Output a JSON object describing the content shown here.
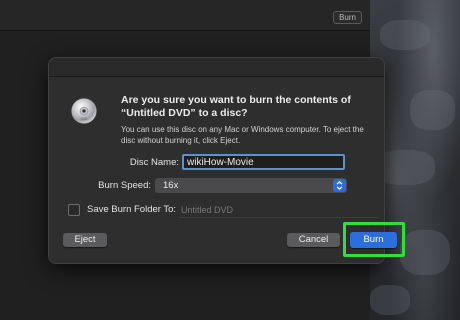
{
  "background_window": {
    "burn_label": "Burn"
  },
  "dialog": {
    "title": "Are you sure you want to burn the contents of “Untitled DVD” to a disc?",
    "description": "You can use this disc on any Mac or Windows computer. To eject the disc without burning it, click Eject.",
    "disc_name_label": "Disc Name:",
    "disc_name_value": "wikiHow-Movie",
    "burn_speed_label": "Burn Speed:",
    "burn_speed_value": "16x",
    "save_folder_label": "Save Burn Folder To:",
    "save_folder_placeholder": "Untitled DVD",
    "eject_label": "Eject",
    "cancel_label": "Cancel",
    "burn_label": "Burn"
  },
  "colors": {
    "accent": "#2a6fdb",
    "highlight": "#2fe03a",
    "focus_ring": "#5e92c9"
  },
  "icons": {
    "disc": "dvd-disc-icon",
    "select": "up-down-chevron-icon"
  }
}
